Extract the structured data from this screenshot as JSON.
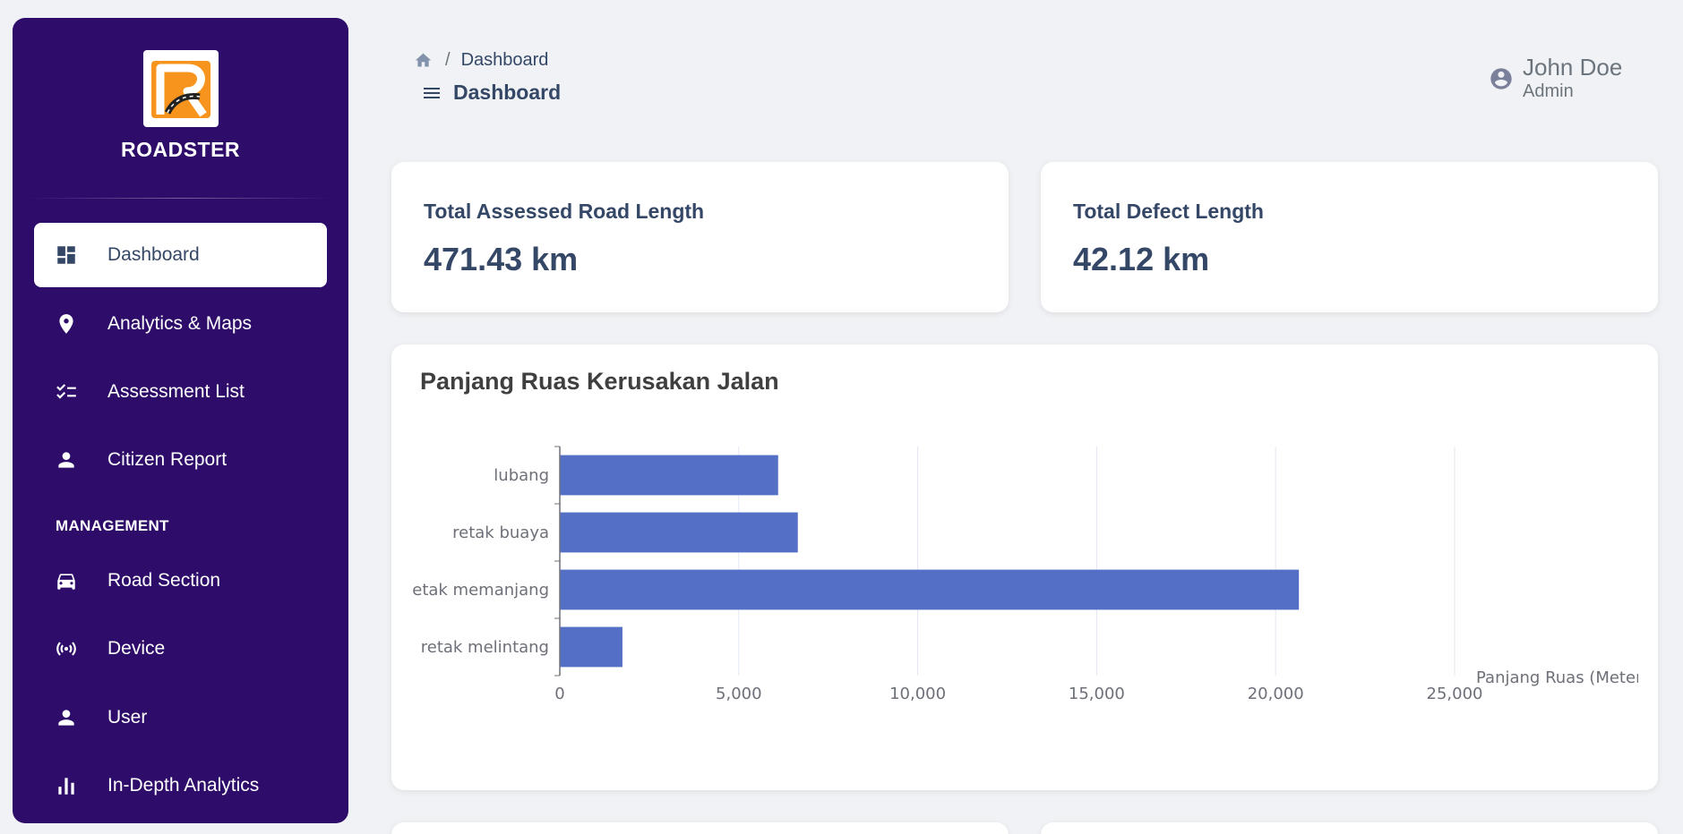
{
  "app": {
    "brand_name": "ROADSTER",
    "colors": {
      "sidebar_bg": "#2e0c69",
      "accent_orange": "#f7941d",
      "bar_color": "#5470c6",
      "text_dark": "#344767"
    }
  },
  "sidebar": {
    "items": [
      {
        "label": "Dashboard",
        "icon": "dashboard-icon",
        "active": true
      },
      {
        "label": "Analytics & Maps",
        "icon": "location-pin-icon"
      },
      {
        "label": "Assessment List",
        "icon": "checklist-icon"
      },
      {
        "label": "Citizen Report",
        "icon": "person-icon"
      }
    ],
    "section_label": "MANAGEMENT",
    "management_items": [
      {
        "label": "Road Section",
        "icon": "car-icon"
      },
      {
        "label": "Device",
        "icon": "broadcast-icon"
      },
      {
        "label": "User",
        "icon": "person-icon"
      },
      {
        "label": "In-Depth Analytics",
        "icon": "bar-chart-icon"
      }
    ]
  },
  "header": {
    "breadcrumb_sep": "/",
    "breadcrumb_current": "Dashboard",
    "page_title": "Dashboard",
    "user_name": "John Doe",
    "user_role": "Admin"
  },
  "stats": [
    {
      "label": "Total Assessed Road Length",
      "value": "471.43 km"
    },
    {
      "label": "Total Defect Length",
      "value": "42.12 km"
    }
  ],
  "chart_data": {
    "type": "bar",
    "orientation": "horizontal",
    "title": "Panjang Ruas Kerusakan Jalan",
    "categories": [
      "lubang",
      "retak buaya",
      "retak memanjang",
      "retak melintang"
    ],
    "values": [
      6100,
      6650,
      20650,
      1750
    ],
    "xlabel": "Panjang Ruas (Meter)",
    "ylabel": "",
    "xlim": [
      0,
      25000
    ],
    "x_ticks": [
      "0",
      "5,000",
      "10,000",
      "15,000",
      "20,000",
      "25,000"
    ],
    "grid": true,
    "legend": "none"
  }
}
